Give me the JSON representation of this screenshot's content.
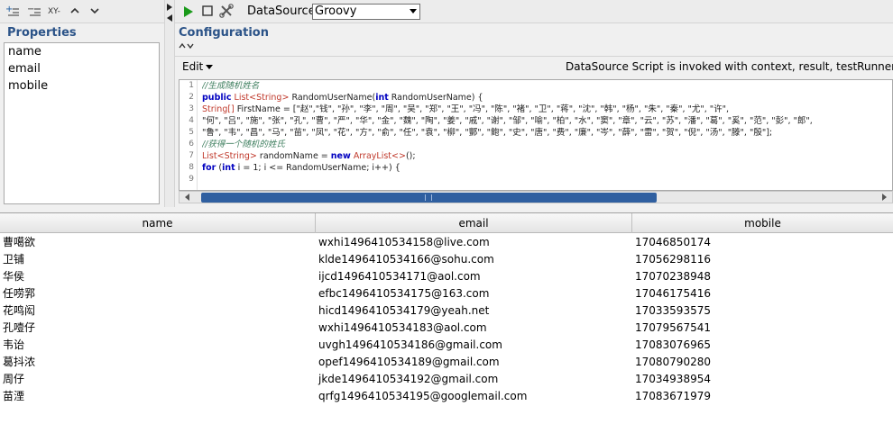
{
  "left_toolbar": {
    "add_label": "+",
    "remove_label": "−",
    "xy_label": "XY-"
  },
  "properties": {
    "title": "Properties",
    "items": [
      "name",
      "email",
      "mobile"
    ]
  },
  "right_toolbar": {
    "datasource_label": "DataSource:",
    "datasource_value": "Groovy"
  },
  "configuration": {
    "title": "Configuration",
    "edit_label": "Edit",
    "info_text": "DataSource Script is invoked with context, result, testRunner, log"
  },
  "code_lines": [
    {
      "n": "1",
      "text": "//生成随机姓名"
    },
    {
      "n": "2",
      "text": "public List<String> RandomUserName(int RandomUserName) {"
    },
    {
      "n": "3",
      "text": "    String[] FirstName = [\"赵\",\"钱\", \"孙\", \"李\", \"周\", \"吴\", \"郑\", \"王\", \"冯\", \"陈\", \"褚\", \"卫\", \"蒋\", \"沈\", \"韩\", \"杨\", \"朱\", \"秦\", \"尤\", \"许\","
    },
    {
      "n": "4",
      "text": "        \"何\", \"吕\", \"施\", \"张\", \"孔\", \"曹\", \"严\", \"华\", \"金\", \"魏\", \"陶\", \"姜\", \"戚\", \"谢\", \"邹\", \"喻\", \"柏\", \"水\", \"窦\", \"章\", \"云\", \"苏\", \"潘\", \"葛\", \"奚\", \"范\", \"彭\", \"郎\","
    },
    {
      "n": "5",
      "text": "        \"鲁\", \"韦\", \"昌\", \"马\", \"苗\", \"凤\", \"花\", \"方\", \"俞\", \"任\", \"袁\", \"柳\", \"酆\", \"鲍\", \"史\", \"唐\", \"费\", \"廉\", \"岑\", \"薛\", \"雷\", \"贺\", \"倪\", \"汤\", \"滕\", \"殷\"];"
    },
    {
      "n": "6",
      "text": "    //获得一个随机的姓氏"
    },
    {
      "n": "7",
      "text": "    List<String> randomName = new ArrayList<>();"
    },
    {
      "n": "8",
      "text": "    for (int i = 1; i <= RandomUserName; i++) {"
    },
    {
      "n": "9",
      "text": ""
    }
  ],
  "table": {
    "columns": [
      "name",
      "email",
      "mobile"
    ],
    "rows": [
      [
        "曹噶欲",
        "wxhi1496410534158@live.com",
        "17046850174"
      ],
      [
        "卫铺",
        "klde1496410534166@sohu.com",
        "17056298116"
      ],
      [
        "华侯",
        "ijcd1496410534171@aol.com",
        "17070238948"
      ],
      [
        "任唠郛",
        "efbc1496410534175@163.com",
        "17046175416"
      ],
      [
        "花鸣闳",
        "hicd1496410534179@yeah.net",
        "17033593575"
      ],
      [
        "孔噎仔",
        "wxhi1496410534183@aol.com",
        "17079567541"
      ],
      [
        "韦诒",
        "uvgh1496410534186@gmail.com",
        "17083076965"
      ],
      [
        "葛抖浓",
        "opef1496410534189@gmail.com",
        "17080790280"
      ],
      [
        "周仔",
        "jkde1496410534192@gmail.com",
        "17034938954"
      ],
      [
        "苗湮",
        "qrfg1496410534195@googlemail.com",
        "17083671979"
      ]
    ]
  },
  "colors": {
    "section_title": "#2b5388",
    "scroll_thumb": "#2f5fa0",
    "run_green": "#1a9a1a"
  }
}
